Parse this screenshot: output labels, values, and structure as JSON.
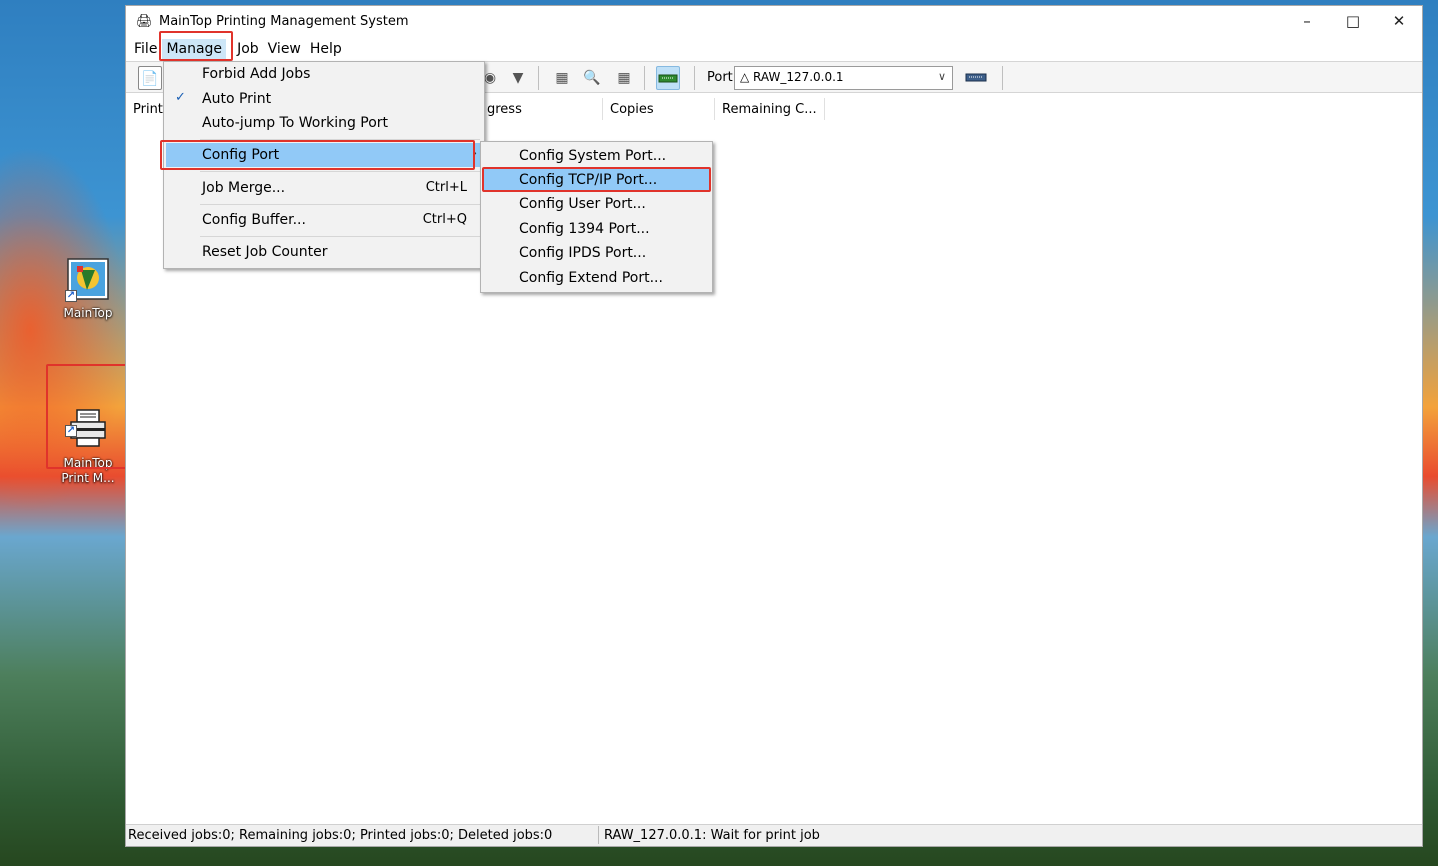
{
  "window": {
    "title": "MainTop Printing Management System",
    "app_icon": "printer-icon",
    "minimize": "–",
    "maximize": "□",
    "close": "✕"
  },
  "menubar": [
    "File",
    "Manage",
    "Job",
    "View",
    "Help"
  ],
  "toolbar": {
    "port_label": "Port:",
    "port_value": "△ RAW_127.0.0.1",
    "port_chevron": "∨"
  },
  "list_headers": [
    "Print",
    "gress",
    "Copies",
    "Remaining C..."
  ],
  "manage_menu": {
    "items": [
      {
        "label": "Forbid Add Jobs",
        "shortcut": ""
      },
      {
        "label": "Auto Print",
        "shortcut": "",
        "checked": true,
        "check_glyph": "✓"
      },
      {
        "label": "Auto-jump To Working Port",
        "shortcut": ""
      },
      {
        "label": "Config Port",
        "shortcut": "",
        "submenu_arrow": "›",
        "highlighted": true
      },
      {
        "label": "Job Merge...",
        "shortcut": "Ctrl+L"
      },
      {
        "label": "Config Buffer...",
        "shortcut": "Ctrl+Q"
      },
      {
        "label": "Reset Job Counter",
        "shortcut": ""
      }
    ]
  },
  "config_port_submenu": {
    "items": [
      {
        "label": "Config System Port..."
      },
      {
        "label": "Config TCP/IP Port...",
        "highlighted": true
      },
      {
        "label": "Config User Port..."
      },
      {
        "label": "Config 1394 Port..."
      },
      {
        "label": "Config IPDS Port..."
      },
      {
        "label": "Config Extend Port..."
      }
    ]
  },
  "statusbar": {
    "jobs": "Received jobs:0; Remaining jobs:0; Printed jobs:0; Deleted jobs:0",
    "port_status": "RAW_127.0.0.1: Wait for print job"
  },
  "desktop_icons": [
    {
      "label": "MainTop",
      "icon": "maintop-app-icon"
    },
    {
      "label": "MainTop\nPrint M...",
      "icon": "maintop-print-manager-icon"
    }
  ],
  "colors": {
    "highlight": "#91c9f7",
    "annotation_box": "#e0332b",
    "menubar_active": "#cde6f7"
  }
}
